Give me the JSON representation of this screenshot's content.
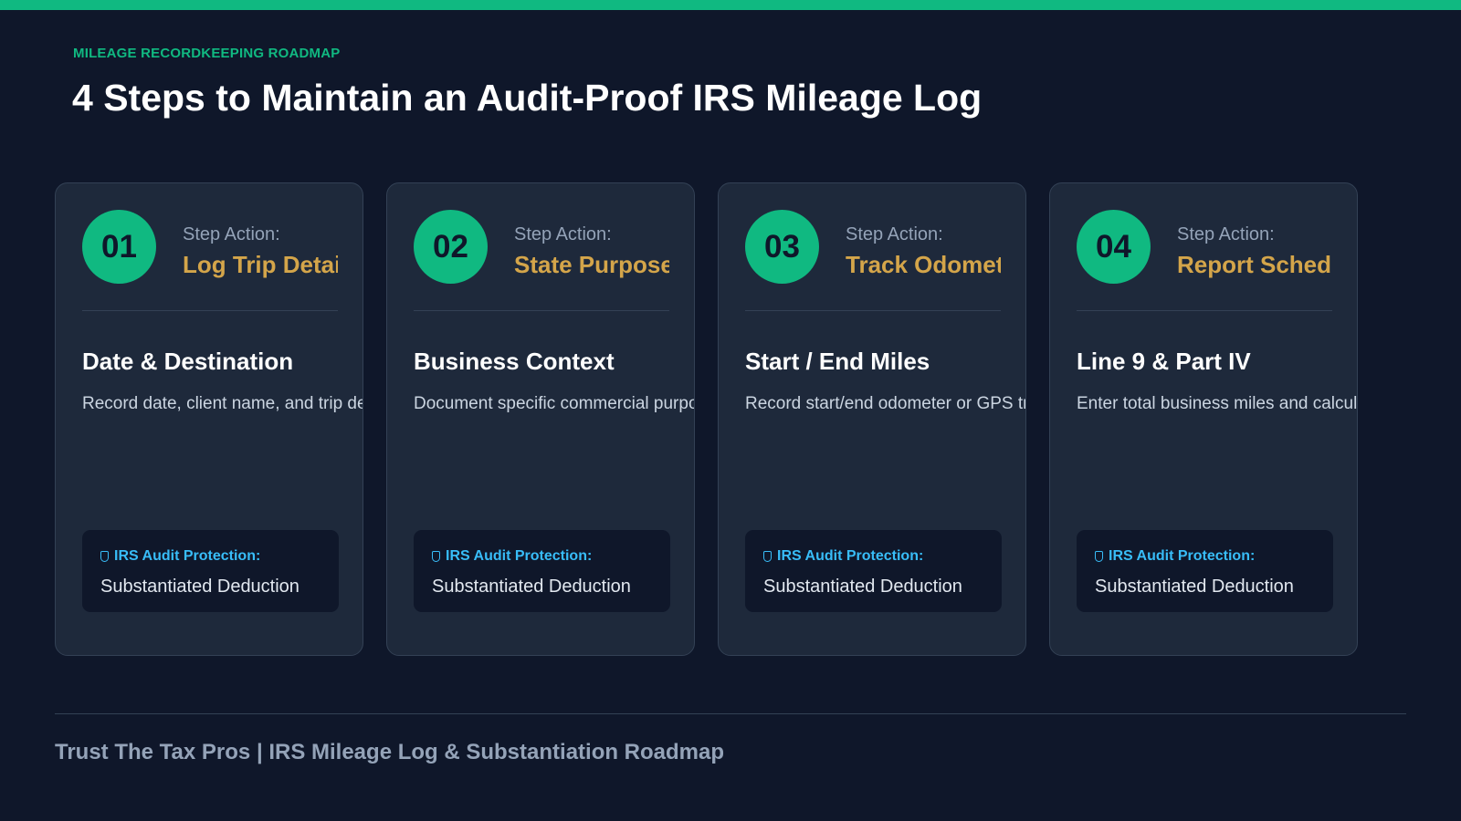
{
  "header": {
    "eyebrow": "MILEAGE RECORDKEEPING ROADMAP",
    "title": "4 Steps to Maintain an Audit-Proof IRS Mileage Log"
  },
  "steps": [
    {
      "number": "01",
      "label": "Step Action:",
      "action": "Log Trip Details",
      "heading": "Date & Destination",
      "description": "Record date, client name, and trip destination",
      "protection_label": "IRS Audit Protection:",
      "protection_value": "Substantiated Deduction"
    },
    {
      "number": "02",
      "label": "Step Action:",
      "action": "State Purpose",
      "heading": "Business Context",
      "description": "Document specific commercial purpose",
      "protection_label": "IRS Audit Protection:",
      "protection_value": "Substantiated Deduction"
    },
    {
      "number": "03",
      "label": "Step Action:",
      "action": "Track Odometer",
      "heading": "Start / End Miles",
      "description": "Record start/end odometer or GPS tracking",
      "protection_label": "IRS Audit Protection:",
      "protection_value": "Substantiated Deduction"
    },
    {
      "number": "04",
      "label": "Step Action:",
      "action": "Report Schedule C",
      "heading": "Line 9 & Part IV",
      "description": "Enter total business miles and calculate deduction",
      "protection_label": "IRS Audit Protection:",
      "protection_value": "Substantiated Deduction"
    }
  ],
  "footer": {
    "text": "Trust The Tax Pros | IRS Mileage Log & Substantiation Roadmap"
  },
  "colors": {
    "background": "#0f172a",
    "card": "#1e293b",
    "accent_green": "#10b981",
    "accent_gold": "#d4a54a",
    "accent_blue": "#38bdf8"
  }
}
